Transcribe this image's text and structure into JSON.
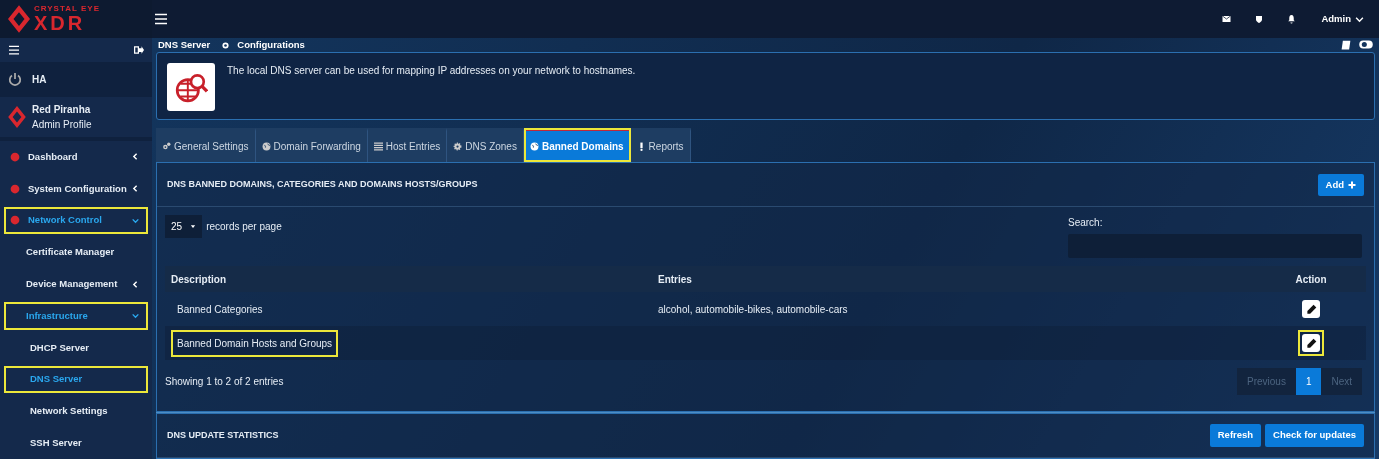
{
  "logo": {
    "brand_small": "CRYSTAL EYE",
    "brand_large": "XDR"
  },
  "topbar": {
    "user": "Admin"
  },
  "sidebar": {
    "ha_label": "HA",
    "profile": {
      "name": "Red Piranha",
      "role": "Admin Profile"
    },
    "items": [
      {
        "label": "Dashboard",
        "kind": "group",
        "expanded": false,
        "selected": false,
        "highlighted": false
      },
      {
        "label": "System Configuration",
        "kind": "group",
        "expanded": false,
        "selected": false,
        "highlighted": false
      },
      {
        "label": "Network Control",
        "kind": "group",
        "expanded": true,
        "selected": true,
        "highlighted": true,
        "children": [
          {
            "label": "Certificate Manager",
            "selected": false,
            "highlighted": false
          },
          {
            "label": "Device Management",
            "kind": "group",
            "expanded": false,
            "selected": false,
            "highlighted": false
          },
          {
            "label": "Infrastructure",
            "kind": "group",
            "expanded": true,
            "selected": true,
            "highlighted": true,
            "children": [
              {
                "label": "DHCP Server",
                "selected": false,
                "highlighted": false
              },
              {
                "label": "DNS Server",
                "selected": true,
                "highlighted": true
              },
              {
                "label": "Network Settings",
                "selected": false,
                "highlighted": false
              },
              {
                "label": "SSH Server",
                "selected": false,
                "highlighted": false
              }
            ]
          }
        ]
      }
    ]
  },
  "breadcrumb": [
    "DNS Server",
    "Configurations"
  ],
  "info_text": "The local DNS server can be used for mapping IP addresses on your network to hostnames.",
  "tabs": [
    {
      "label": "General Settings",
      "kind": "gears",
      "selected": false,
      "highlighted": false
    },
    {
      "label": "Domain Forwarding",
      "kind": "globe",
      "selected": false,
      "highlighted": false
    },
    {
      "label": "Host Entries",
      "kind": "list",
      "selected": false,
      "highlighted": false
    },
    {
      "label": "DNS Zones",
      "kind": "gear",
      "selected": false,
      "highlighted": false
    },
    {
      "label": "Banned Domains",
      "kind": "globe",
      "selected": true,
      "highlighted": true
    },
    {
      "label": "Reports",
      "kind": "exclamation",
      "selected": false,
      "highlighted": false
    }
  ],
  "panel": {
    "title": "DNS BANNED DOMAINS, CATEGORIES AND DOMAINS HOSTS/GROUPS",
    "add_button": "Add",
    "page_length": "25",
    "page_length_label": "records per page",
    "search_label": "Search:",
    "columns": [
      "Description",
      "Entries",
      "Action"
    ],
    "rows": [
      {
        "description": "Banned Categories",
        "entries": "alcohol, automobile-bikes, automobile-cars",
        "highlighted": false
      },
      {
        "description": "Banned Domain Hosts and Groups",
        "highlighted": true
      }
    ],
    "summary": "Showing 1 to 2 of 2 entries",
    "pagination": {
      "previous": "Previous",
      "next": "Next",
      "pages": [
        {
          "label": "1",
          "selected": true
        }
      ]
    }
  },
  "stats_panel": {
    "title": "DNS UPDATE STATISTICS",
    "buttons": [
      "Refresh",
      "Check for updates"
    ]
  }
}
